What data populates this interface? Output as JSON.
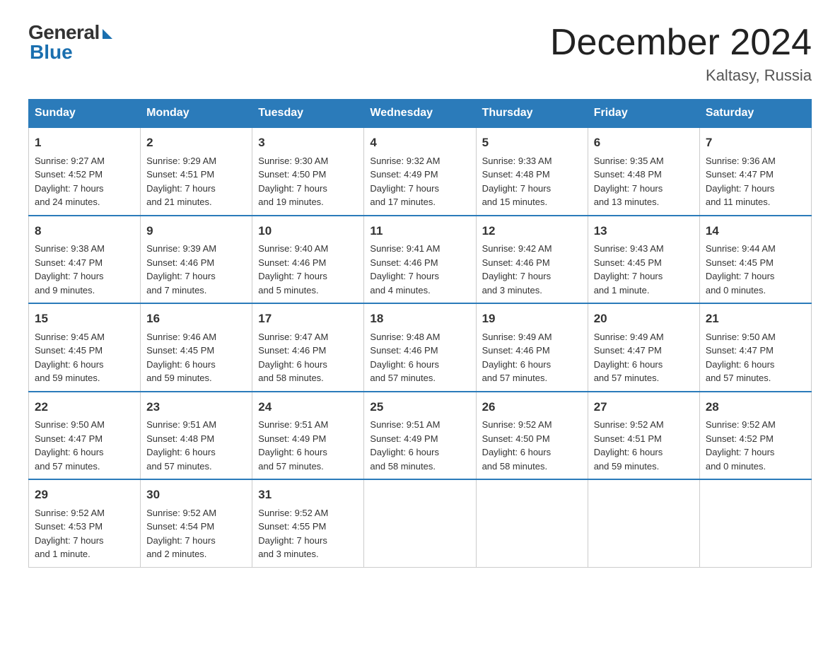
{
  "header": {
    "logo_general": "General",
    "logo_blue": "Blue",
    "month_year": "December 2024",
    "location": "Kaltasy, Russia"
  },
  "days_of_week": [
    "Sunday",
    "Monday",
    "Tuesday",
    "Wednesday",
    "Thursday",
    "Friday",
    "Saturday"
  ],
  "weeks": [
    [
      {
        "day": "1",
        "info": "Sunrise: 9:27 AM\nSunset: 4:52 PM\nDaylight: 7 hours\nand 24 minutes."
      },
      {
        "day": "2",
        "info": "Sunrise: 9:29 AM\nSunset: 4:51 PM\nDaylight: 7 hours\nand 21 minutes."
      },
      {
        "day": "3",
        "info": "Sunrise: 9:30 AM\nSunset: 4:50 PM\nDaylight: 7 hours\nand 19 minutes."
      },
      {
        "day": "4",
        "info": "Sunrise: 9:32 AM\nSunset: 4:49 PM\nDaylight: 7 hours\nand 17 minutes."
      },
      {
        "day": "5",
        "info": "Sunrise: 9:33 AM\nSunset: 4:48 PM\nDaylight: 7 hours\nand 15 minutes."
      },
      {
        "day": "6",
        "info": "Sunrise: 9:35 AM\nSunset: 4:48 PM\nDaylight: 7 hours\nand 13 minutes."
      },
      {
        "day": "7",
        "info": "Sunrise: 9:36 AM\nSunset: 4:47 PM\nDaylight: 7 hours\nand 11 minutes."
      }
    ],
    [
      {
        "day": "8",
        "info": "Sunrise: 9:38 AM\nSunset: 4:47 PM\nDaylight: 7 hours\nand 9 minutes."
      },
      {
        "day": "9",
        "info": "Sunrise: 9:39 AM\nSunset: 4:46 PM\nDaylight: 7 hours\nand 7 minutes."
      },
      {
        "day": "10",
        "info": "Sunrise: 9:40 AM\nSunset: 4:46 PM\nDaylight: 7 hours\nand 5 minutes."
      },
      {
        "day": "11",
        "info": "Sunrise: 9:41 AM\nSunset: 4:46 PM\nDaylight: 7 hours\nand 4 minutes."
      },
      {
        "day": "12",
        "info": "Sunrise: 9:42 AM\nSunset: 4:46 PM\nDaylight: 7 hours\nand 3 minutes."
      },
      {
        "day": "13",
        "info": "Sunrise: 9:43 AM\nSunset: 4:45 PM\nDaylight: 7 hours\nand 1 minute."
      },
      {
        "day": "14",
        "info": "Sunrise: 9:44 AM\nSunset: 4:45 PM\nDaylight: 7 hours\nand 0 minutes."
      }
    ],
    [
      {
        "day": "15",
        "info": "Sunrise: 9:45 AM\nSunset: 4:45 PM\nDaylight: 6 hours\nand 59 minutes."
      },
      {
        "day": "16",
        "info": "Sunrise: 9:46 AM\nSunset: 4:45 PM\nDaylight: 6 hours\nand 59 minutes."
      },
      {
        "day": "17",
        "info": "Sunrise: 9:47 AM\nSunset: 4:46 PM\nDaylight: 6 hours\nand 58 minutes."
      },
      {
        "day": "18",
        "info": "Sunrise: 9:48 AM\nSunset: 4:46 PM\nDaylight: 6 hours\nand 57 minutes."
      },
      {
        "day": "19",
        "info": "Sunrise: 9:49 AM\nSunset: 4:46 PM\nDaylight: 6 hours\nand 57 minutes."
      },
      {
        "day": "20",
        "info": "Sunrise: 9:49 AM\nSunset: 4:47 PM\nDaylight: 6 hours\nand 57 minutes."
      },
      {
        "day": "21",
        "info": "Sunrise: 9:50 AM\nSunset: 4:47 PM\nDaylight: 6 hours\nand 57 minutes."
      }
    ],
    [
      {
        "day": "22",
        "info": "Sunrise: 9:50 AM\nSunset: 4:47 PM\nDaylight: 6 hours\nand 57 minutes."
      },
      {
        "day": "23",
        "info": "Sunrise: 9:51 AM\nSunset: 4:48 PM\nDaylight: 6 hours\nand 57 minutes."
      },
      {
        "day": "24",
        "info": "Sunrise: 9:51 AM\nSunset: 4:49 PM\nDaylight: 6 hours\nand 57 minutes."
      },
      {
        "day": "25",
        "info": "Sunrise: 9:51 AM\nSunset: 4:49 PM\nDaylight: 6 hours\nand 58 minutes."
      },
      {
        "day": "26",
        "info": "Sunrise: 9:52 AM\nSunset: 4:50 PM\nDaylight: 6 hours\nand 58 minutes."
      },
      {
        "day": "27",
        "info": "Sunrise: 9:52 AM\nSunset: 4:51 PM\nDaylight: 6 hours\nand 59 minutes."
      },
      {
        "day": "28",
        "info": "Sunrise: 9:52 AM\nSunset: 4:52 PM\nDaylight: 7 hours\nand 0 minutes."
      }
    ],
    [
      {
        "day": "29",
        "info": "Sunrise: 9:52 AM\nSunset: 4:53 PM\nDaylight: 7 hours\nand 1 minute."
      },
      {
        "day": "30",
        "info": "Sunrise: 9:52 AM\nSunset: 4:54 PM\nDaylight: 7 hours\nand 2 minutes."
      },
      {
        "day": "31",
        "info": "Sunrise: 9:52 AM\nSunset: 4:55 PM\nDaylight: 7 hours\nand 3 minutes."
      },
      {
        "day": "",
        "info": ""
      },
      {
        "day": "",
        "info": ""
      },
      {
        "day": "",
        "info": ""
      },
      {
        "day": "",
        "info": ""
      }
    ]
  ]
}
